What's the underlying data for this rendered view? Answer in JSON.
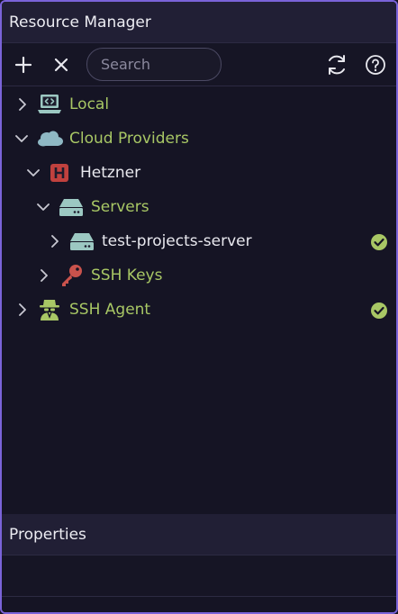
{
  "panel": {
    "title": "Resource Manager"
  },
  "toolbar": {
    "add_icon": "plus-icon",
    "close_icon": "x-icon",
    "search_placeholder": "Search",
    "refresh_icon": "refresh-icon",
    "help_icon": "help-circle-icon"
  },
  "tree": [
    {
      "label": "Local",
      "icon": "computer-code-icon",
      "expanded": false,
      "status": null
    },
    {
      "label": "Cloud Providers",
      "icon": "cloud-icon",
      "expanded": true,
      "status": null
    },
    {
      "label": "Hetzner",
      "icon": "hetzner-logo-icon",
      "expanded": true,
      "status": null
    },
    {
      "label": "Servers",
      "icon": "server-icon",
      "expanded": true,
      "status": null
    },
    {
      "label": "test-projects-server",
      "icon": "server-icon",
      "expanded": false,
      "status": "check-circle-icon"
    },
    {
      "label": "SSH Keys",
      "icon": "key-icon",
      "expanded": false,
      "status": null
    },
    {
      "label": "SSH Agent",
      "icon": "agent-spy-icon",
      "expanded": false,
      "status": "check-circle-icon"
    }
  ],
  "properties": {
    "title": "Properties"
  },
  "colors": {
    "accent_border": "#7a63d8",
    "label_green": "#a8c765",
    "hetzner_red": "#c0413e",
    "key_red": "#c9524c",
    "icon_teal": "#9cc8c2"
  }
}
